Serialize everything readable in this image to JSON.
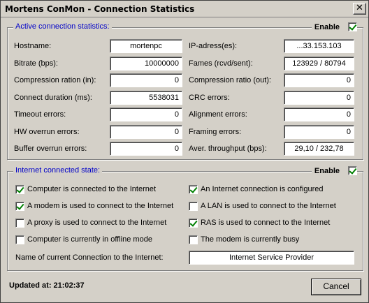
{
  "window": {
    "title": "Mortens ConMon - Connection Statistics",
    "close_glyph": "✕"
  },
  "stats": {
    "title": "Active connection statistics:",
    "enable_label": "Enable",
    "enabled": true,
    "left": [
      {
        "label": "Hostname:",
        "value": "mortenpc",
        "align": "center"
      },
      {
        "label": "Bitrate (bps):",
        "value": "10000000",
        "align": "right"
      },
      {
        "label": "Compression ration (in):",
        "value": "0",
        "align": "right"
      },
      {
        "label": "Connect duration (ms):",
        "value": "5538031",
        "align": "right"
      },
      {
        "label": "Timeout errors:",
        "value": "0",
        "align": "right"
      },
      {
        "label": "HW overrun errors:",
        "value": "0",
        "align": "right"
      },
      {
        "label": "Buffer overrun errors:",
        "value": "0",
        "align": "right"
      }
    ],
    "right": [
      {
        "label": "IP-adress(es):",
        "value": "...33.153.103",
        "align": "center"
      },
      {
        "label": "Fames (rcvd/sent):",
        "value": "123929 / 80794",
        "align": "center"
      },
      {
        "label": "Compression ratio (out):",
        "value": "0",
        "align": "right"
      },
      {
        "label": "CRC errors:",
        "value": "0",
        "align": "right"
      },
      {
        "label": "Alignment errors:",
        "value": "0",
        "align": "right"
      },
      {
        "label": "Framing errors:",
        "value": "0",
        "align": "right"
      },
      {
        "label": "Aver. throughput (bps):",
        "value": "29,10 / 232,78",
        "align": "center"
      }
    ]
  },
  "internet": {
    "title": "Internet connected state:",
    "enable_label": "Enable",
    "enabled": true,
    "left": [
      {
        "label": "Computer is connected to the Internet",
        "checked": true
      },
      {
        "label": "A modem is used to connect to the Internet",
        "checked": true
      },
      {
        "label": "A proxy is used to connect to the Internet",
        "checked": false
      },
      {
        "label": "Computer is currently in offline mode",
        "checked": false
      }
    ],
    "right": [
      {
        "label": "An Internet connection is configured",
        "checked": true
      },
      {
        "label": "A LAN is used to connect to the Internet",
        "checked": false
      },
      {
        "label": "RAS is used to connect to the Internet",
        "checked": true
      },
      {
        "label": "The modem is currently busy",
        "checked": false
      }
    ],
    "connection_label": "Name of current Connection to the Internet:",
    "connection_value": "Internet Service Provider"
  },
  "footer": {
    "updated": "Updated at: 21:02:37",
    "cancel_label": "Cancel"
  }
}
